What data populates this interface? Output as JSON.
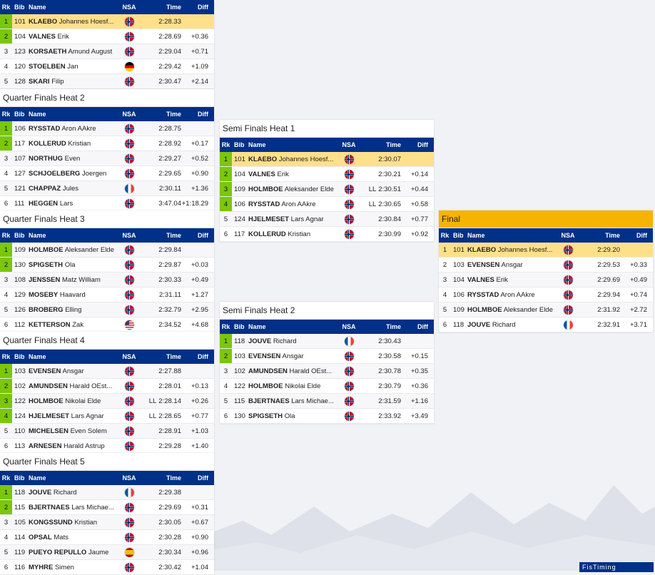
{
  "headers": {
    "rk": "Rk",
    "bib": "Bib",
    "name": "Name",
    "nsa": "NSA",
    "time": "Time",
    "diff": "Diff"
  },
  "heats": [
    {
      "id": "qf1",
      "title": "",
      "rows": [
        {
          "rk": "1",
          "bib": "101",
          "last": "KLAEBO",
          "first": "Johannes Hoesf...",
          "nsa": "nor",
          "time": "2:28.33",
          "diff": "",
          "q": true,
          "hl": true
        },
        {
          "rk": "2",
          "bib": "104",
          "last": "VALNES",
          "first": "Erik",
          "nsa": "nor",
          "time": "2:28.69",
          "diff": "+0.36",
          "q": true
        },
        {
          "rk": "3",
          "bib": "123",
          "last": "KORSAETH",
          "first": "Amund August",
          "nsa": "nor",
          "time": "2:29.04",
          "diff": "+0.71"
        },
        {
          "rk": "4",
          "bib": "120",
          "last": "STOELBEN",
          "first": "Jan",
          "nsa": "ger",
          "time": "2:29.42",
          "diff": "+1.09"
        },
        {
          "rk": "5",
          "bib": "128",
          "last": "SKARI",
          "first": "Filip",
          "nsa": "nor",
          "time": "2:30.47",
          "diff": "+2.14"
        }
      ]
    },
    {
      "id": "qf2",
      "title": "Quarter Finals Heat 2",
      "rows": [
        {
          "rk": "1",
          "bib": "106",
          "last": "RYSSTAD",
          "first": "Aron AAkre",
          "nsa": "nor",
          "time": "2:28.75",
          "diff": "",
          "q": true
        },
        {
          "rk": "2",
          "bib": "117",
          "last": "KOLLERUD",
          "first": "Kristian",
          "nsa": "nor",
          "time": "2:28.92",
          "diff": "+0.17",
          "q": true
        },
        {
          "rk": "3",
          "bib": "107",
          "last": "NORTHUG",
          "first": "Even",
          "nsa": "nor",
          "time": "2:29.27",
          "diff": "+0.52"
        },
        {
          "rk": "4",
          "bib": "127",
          "last": "SCHJOELBERG",
          "first": "Joergen",
          "nsa": "nor",
          "time": "2:29.65",
          "diff": "+0.90"
        },
        {
          "rk": "5",
          "bib": "121",
          "last": "CHAPPAZ",
          "first": "Jules",
          "nsa": "fra",
          "time": "2:30.11",
          "diff": "+1.36"
        },
        {
          "rk": "6",
          "bib": "111",
          "last": "HEGGEN",
          "first": "Lars",
          "nsa": "nor",
          "time": "3:47.04",
          "diff": "+1:18.29"
        }
      ]
    },
    {
      "id": "qf3",
      "title": "Quarter Finals Heat 3",
      "rows": [
        {
          "rk": "1",
          "bib": "109",
          "last": "HOLMBOE",
          "first": "Aleksander Elde",
          "nsa": "nor",
          "time": "2:29.84",
          "diff": "",
          "q": true
        },
        {
          "rk": "2",
          "bib": "130",
          "last": "SPIGSETH",
          "first": "Ola",
          "nsa": "nor",
          "time": "2:29.87",
          "diff": "+0.03",
          "q": true
        },
        {
          "rk": "3",
          "bib": "108",
          "last": "JENSSEN",
          "first": "Matz William",
          "nsa": "nor",
          "time": "2:30.33",
          "diff": "+0.49"
        },
        {
          "rk": "4",
          "bib": "129",
          "last": "MOSEBY",
          "first": "Haavard",
          "nsa": "nor",
          "time": "2:31.11",
          "diff": "+1.27"
        },
        {
          "rk": "5",
          "bib": "126",
          "last": "BROBERG",
          "first": "Elling",
          "nsa": "nor",
          "time": "2:32.79",
          "diff": "+2.95"
        },
        {
          "rk": "6",
          "bib": "112",
          "last": "KETTERSON",
          "first": "Zak",
          "nsa": "usa",
          "time": "2:34.52",
          "diff": "+4.68"
        }
      ]
    },
    {
      "id": "qf4",
      "title": "Quarter Finals Heat 4",
      "rows": [
        {
          "rk": "1",
          "bib": "103",
          "last": "EVENSEN",
          "first": "Ansgar",
          "nsa": "nor",
          "time": "2:27.88",
          "diff": "",
          "q": true
        },
        {
          "rk": "2",
          "bib": "102",
          "last": "AMUNDSEN",
          "first": "Harald OEst...",
          "nsa": "nor",
          "time": "2:28.01",
          "diff": "+0.13",
          "q": true
        },
        {
          "rk": "3",
          "bib": "122",
          "last": "HOLMBOE",
          "first": "Nikolai Elde",
          "nsa": "nor",
          "ll": "LL",
          "time": "2:28.14",
          "diff": "+0.26",
          "q": true
        },
        {
          "rk": "4",
          "bib": "124",
          "last": "HJELMESET",
          "first": "Lars Agnar",
          "nsa": "nor",
          "ll": "LL",
          "time": "2:28.65",
          "diff": "+0.77",
          "q": true
        },
        {
          "rk": "5",
          "bib": "110",
          "last": "MICHELSEN",
          "first": "Even Solem",
          "nsa": "nor",
          "time": "2:28.91",
          "diff": "+1.03"
        },
        {
          "rk": "6",
          "bib": "113",
          "last": "ARNESEN",
          "first": "Harald Astrup",
          "nsa": "nor",
          "time": "2:29.28",
          "diff": "+1.40"
        }
      ]
    },
    {
      "id": "qf5",
      "title": "Quarter Finals Heat 5",
      "rows": [
        {
          "rk": "1",
          "bib": "118",
          "last": "JOUVE",
          "first": "Richard",
          "nsa": "fra",
          "time": "2:29.38",
          "diff": "",
          "q": true
        },
        {
          "rk": "2",
          "bib": "115",
          "last": "BJERTNAES",
          "first": "Lars Michae...",
          "nsa": "nor",
          "time": "2:29.69",
          "diff": "+0.31",
          "q": true
        },
        {
          "rk": "3",
          "bib": "105",
          "last": "KONGSSUND",
          "first": "Kristian",
          "nsa": "nor",
          "time": "2:30.05",
          "diff": "+0.67"
        },
        {
          "rk": "4",
          "bib": "114",
          "last": "OPSAL",
          "first": "Mats",
          "nsa": "nor",
          "time": "2:30.28",
          "diff": "+0.90"
        },
        {
          "rk": "5",
          "bib": "119",
          "last": "PUEYO REPULLO",
          "first": "Jaume",
          "nsa": "esp",
          "time": "2:30.34",
          "diff": "+0.96"
        },
        {
          "rk": "6",
          "bib": "116",
          "last": "MYHRE",
          "first": "Simen",
          "nsa": "nor",
          "time": "2:30.42",
          "diff": "+1.04"
        }
      ]
    },
    {
      "id": "sf1",
      "title": "Semi Finals Heat 1",
      "rows": [
        {
          "rk": "1",
          "bib": "101",
          "last": "KLAEBO",
          "first": "Johannes Hoesf...",
          "nsa": "nor",
          "time": "2:30.07",
          "diff": "",
          "q": true,
          "hl": true
        },
        {
          "rk": "2",
          "bib": "104",
          "last": "VALNES",
          "first": "Erik",
          "nsa": "nor",
          "time": "2:30.21",
          "diff": "+0.14",
          "q": true
        },
        {
          "rk": "3",
          "bib": "109",
          "last": "HOLMBOE",
          "first": "Aleksander Elde",
          "nsa": "nor",
          "ll": "LL",
          "time": "2:30.51",
          "diff": "+0.44",
          "q": true
        },
        {
          "rk": "4",
          "bib": "106",
          "last": "RYSSTAD",
          "first": "Aron AAkre",
          "nsa": "nor",
          "ll": "LL",
          "time": "2:30.65",
          "diff": "+0.58",
          "q": true
        },
        {
          "rk": "5",
          "bib": "124",
          "last": "HJELMESET",
          "first": "Lars Agnar",
          "nsa": "nor",
          "time": "2:30.84",
          "diff": "+0.77"
        },
        {
          "rk": "6",
          "bib": "117",
          "last": "KOLLERUD",
          "first": "Kristian",
          "nsa": "nor",
          "time": "2:30.99",
          "diff": "+0.92"
        }
      ]
    },
    {
      "id": "sf2",
      "title": "Semi Finals Heat 2",
      "rows": [
        {
          "rk": "1",
          "bib": "118",
          "last": "JOUVE",
          "first": "Richard",
          "nsa": "fra",
          "time": "2:30.43",
          "diff": "",
          "q": true
        },
        {
          "rk": "2",
          "bib": "103",
          "last": "EVENSEN",
          "first": "Ansgar",
          "nsa": "nor",
          "time": "2:30.58",
          "diff": "+0.15",
          "q": true
        },
        {
          "rk": "3",
          "bib": "102",
          "last": "AMUNDSEN",
          "first": "Harald OEst...",
          "nsa": "nor",
          "time": "2:30.78",
          "diff": "+0.35"
        },
        {
          "rk": "4",
          "bib": "122",
          "last": "HOLMBOE",
          "first": "Nikolai Elde",
          "nsa": "nor",
          "time": "2:30.79",
          "diff": "+0.36"
        },
        {
          "rk": "5",
          "bib": "115",
          "last": "BJERTNAES",
          "first": "Lars Michae...",
          "nsa": "nor",
          "time": "2:31.59",
          "diff": "+1.16"
        },
        {
          "rk": "6",
          "bib": "130",
          "last": "SPIGSETH",
          "first": "Ola",
          "nsa": "nor",
          "time": "2:33.92",
          "diff": "+3.49"
        }
      ]
    },
    {
      "id": "final",
      "title": "Final",
      "rows": [
        {
          "rk": "1",
          "bib": "101",
          "last": "KLAEBO",
          "first": "Johannes Hoesf...",
          "nsa": "nor",
          "time": "2:29.20",
          "diff": "",
          "hl": true
        },
        {
          "rk": "2",
          "bib": "103",
          "last": "EVENSEN",
          "first": "Ansgar",
          "nsa": "nor",
          "time": "2:29.53",
          "diff": "+0.33"
        },
        {
          "rk": "3",
          "bib": "104",
          "last": "VALNES",
          "first": "Erik",
          "nsa": "nor",
          "time": "2:29.69",
          "diff": "+0.49"
        },
        {
          "rk": "4",
          "bib": "106",
          "last": "RYSSTAD",
          "first": "Aron AAkre",
          "nsa": "nor",
          "time": "2:29.94",
          "diff": "+0.74"
        },
        {
          "rk": "5",
          "bib": "109",
          "last": "HOLMBOE",
          "first": "Aleksander Elde",
          "nsa": "nor",
          "time": "2:31.92",
          "diff": "+2.72"
        },
        {
          "rk": "6",
          "bib": "118",
          "last": "JOUVE",
          "first": "Richard",
          "nsa": "fra",
          "time": "2:32.91",
          "diff": "+3.71"
        }
      ]
    }
  ],
  "logo": "FisTiming",
  "colors": {
    "header": "#003087",
    "qualified": "#7ac70c",
    "highlight": "#ffe08a",
    "final": "#f5b400"
  }
}
